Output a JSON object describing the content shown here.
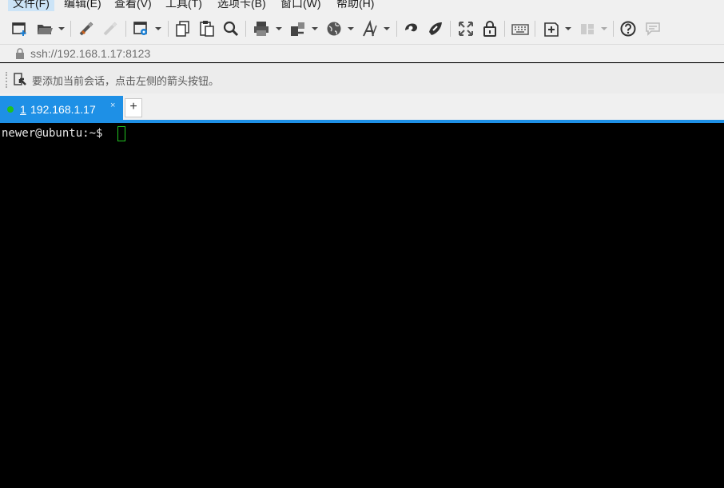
{
  "menubar": {
    "items": [
      {
        "label": "文件(F)"
      },
      {
        "label": "编辑(E)"
      },
      {
        "label": "查看(V)"
      },
      {
        "label": "工具(T)"
      },
      {
        "label": "选项卡(B)"
      },
      {
        "label": "窗口(W)"
      },
      {
        "label": "帮助(H)"
      }
    ]
  },
  "toolbar": {
    "icons": [
      "new-session-icon",
      "open-folder-icon",
      "connect-icon",
      "disconnect-icon",
      "session-properties-icon",
      "copy-icon",
      "paste-icon",
      "find-icon",
      "print-icon",
      "transfer-icon",
      "globe-icon",
      "font-icon",
      "xftp-icon",
      "xshell-script-icon",
      "fullscreen-icon",
      "lock-icon",
      "keyboard-icon",
      "new-tab-icon",
      "layout-icon",
      "help-icon",
      "chat-icon"
    ]
  },
  "address": {
    "url": "ssh://192.168.1.17:8123"
  },
  "hint": {
    "text": "要添加当前会话，点击左侧的箭头按钮。"
  },
  "tabs": [
    {
      "number": "1",
      "label": " 192.168.1.17",
      "close": "×",
      "status_color": "#1fc11f"
    }
  ],
  "add_tab_label": "+",
  "terminal": {
    "prompt": "newer@ubuntu:~$ ",
    "cursor_color": "#22c322"
  },
  "colors": {
    "accent": "#1e90e6",
    "terminal_bg": "#000000"
  }
}
